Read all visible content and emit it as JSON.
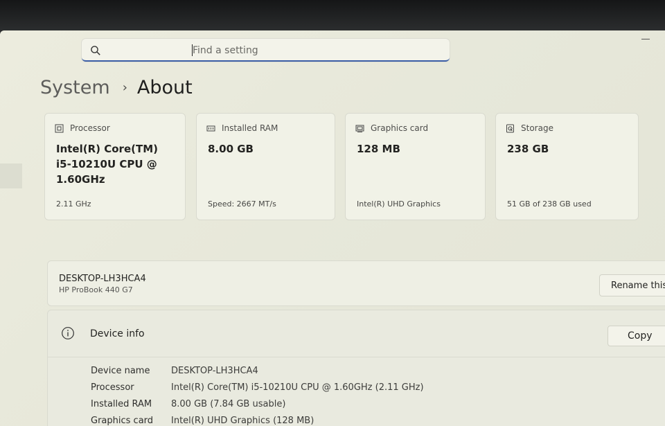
{
  "search": {
    "placeholder": "Find a setting",
    "icon": "search-icon"
  },
  "breadcrumb": {
    "parent": "System",
    "separator": "›",
    "current": "About"
  },
  "cards": [
    {
      "icon": "processor-icon",
      "title": "Processor",
      "value": "Intel(R) Core(TM) i5-10210U CPU @ 1.60GHz",
      "sub": "2.11 GHz"
    },
    {
      "icon": "ram-icon",
      "title": "Installed RAM",
      "value": "8.00 GB",
      "sub": "Speed: 2667 MT/s"
    },
    {
      "icon": "graphics-card-icon",
      "title": "Graphics card",
      "value": "128 MB",
      "sub": "Intel(R) UHD Graphics"
    },
    {
      "icon": "storage-icon",
      "title": "Storage",
      "value": "238 GB",
      "sub": "51 GB of 238 GB used"
    }
  ],
  "device": {
    "name": "DESKTOP-LH3HCA4",
    "model": "HP ProBook 440 G7",
    "rename_label": "Rename this"
  },
  "device_info": {
    "icon": "info-icon",
    "title": "Device info",
    "copy_label": "Copy",
    "rows": [
      {
        "key": "Device name",
        "value": "DESKTOP-LH3HCA4"
      },
      {
        "key": "Processor",
        "value": "Intel(R) Core(TM) i5-10210U CPU @ 1.60GHz (2.11 GHz)"
      },
      {
        "key": "Installed RAM",
        "value": "8.00 GB (7.84 GB usable)"
      },
      {
        "key": "Graphics card",
        "value": "Intel(R) UHD Graphics (128 MB)"
      }
    ]
  },
  "colors": {
    "accent": "#3b5ea6",
    "background": "#e7e8da",
    "card": "#f1f2e7"
  }
}
